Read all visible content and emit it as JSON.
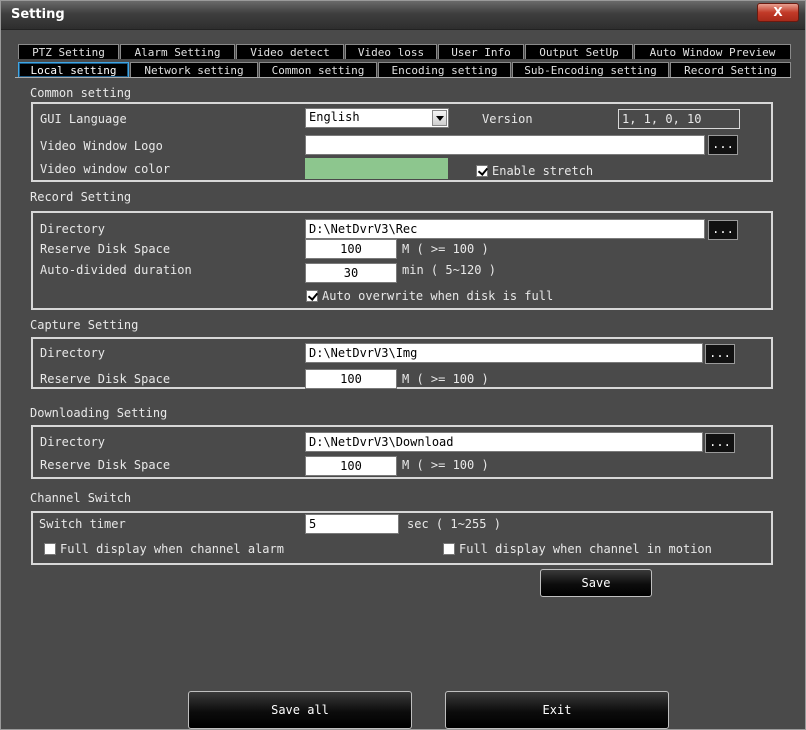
{
  "window": {
    "title": "Setting",
    "close_label": "X"
  },
  "tabs_row1": [
    "PTZ Setting",
    "Alarm Setting",
    "Video detect",
    "Video loss",
    "User Info",
    "Output SetUp",
    "Auto Window Preview"
  ],
  "tabs_row2": [
    "Local setting",
    "Network setting",
    "Common setting",
    "Encoding setting",
    "Sub-Encoding setting",
    "Record Setting"
  ],
  "active_tab": "Local setting",
  "common": {
    "title": "Common setting",
    "gui_language_label": "GUI Language",
    "gui_language_value": "English",
    "version_label": "Version",
    "version_value": "1, 1, 0, 10",
    "logo_label": "Video Window Logo",
    "logo_value": "",
    "color_label": "Video window color",
    "window_color": "#8dc68e",
    "stretch_label": "Enable stretch",
    "stretch_checked": true
  },
  "record": {
    "title": "Record Setting",
    "directory_label": "Directory",
    "directory_value": "D:\\NetDvrV3\\Rec",
    "reserve_label": "Reserve Disk Space",
    "reserve_value": "100",
    "reserve_unit": "M ( >= 100 )",
    "duration_label": "Auto-divided duration",
    "duration_value": "30",
    "duration_unit": "min ( 5~120 )",
    "overwrite_label": "Auto overwrite when disk is full",
    "overwrite_checked": true
  },
  "capture": {
    "title": "Capture Setting",
    "directory_label": "Directory",
    "directory_value": "D:\\NetDvrV3\\Img",
    "reserve_label": "Reserve Disk Space",
    "reserve_value": "100",
    "reserve_unit": "M ( >= 100 )"
  },
  "download": {
    "title": "Downloading Setting",
    "directory_label": "Directory",
    "directory_value": "D:\\NetDvrV3\\Download",
    "reserve_label": "Reserve Disk Space",
    "reserve_value": "100",
    "reserve_unit": "M ( >= 100 )"
  },
  "channel": {
    "title": "Channel Switch",
    "timer_label": "Switch timer",
    "timer_value": "5",
    "timer_unit": "sec ( 1~255 )",
    "alarm_label": "Full display when channel alarm",
    "alarm_checked": false,
    "motion_label": "Full display when channel in motion",
    "motion_checked": false
  },
  "buttons": {
    "browse": "...",
    "save": "Save",
    "save_all": "Save all",
    "exit": "Exit"
  }
}
